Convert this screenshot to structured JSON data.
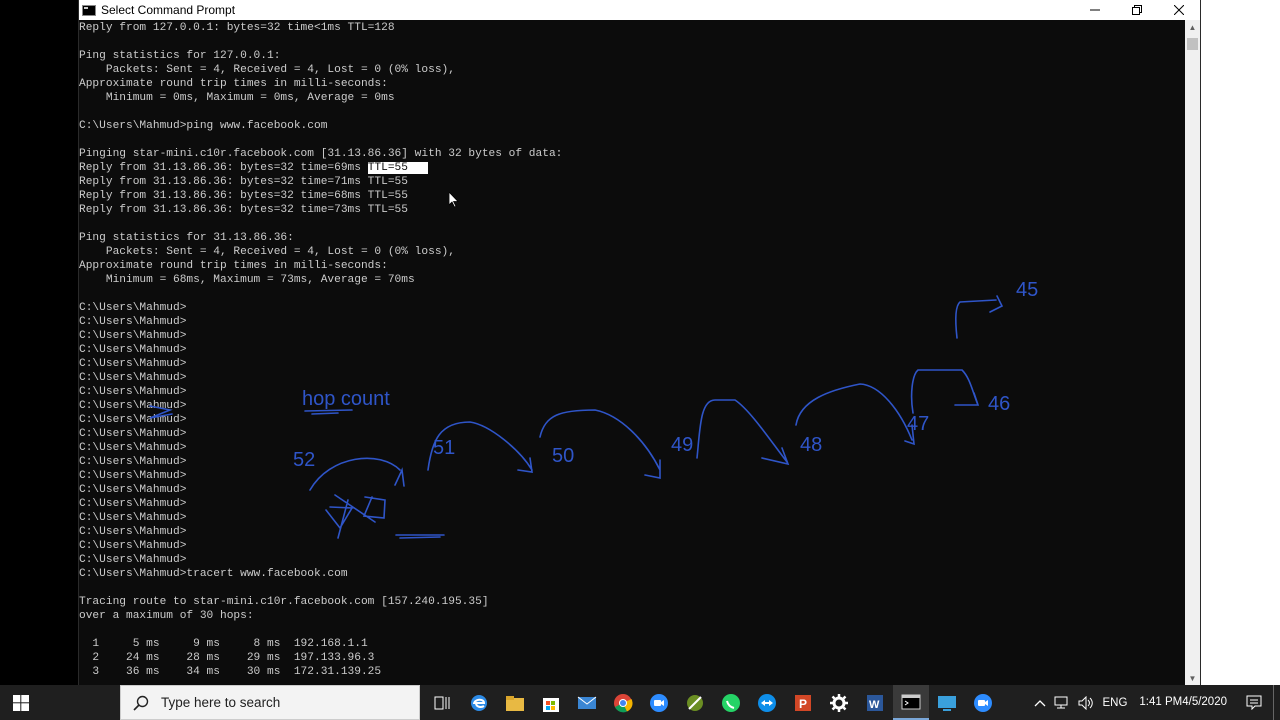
{
  "window": {
    "title": "Select Command Prompt",
    "minimize_icon": "minimize-icon",
    "maximize_icon": "maximize-icon",
    "close_icon": "close-icon"
  },
  "console": {
    "text_before_selection": "Reply from 127.0.0.1: bytes=32 time<1ms TTL=128\n\nPing statistics for 127.0.0.1:\n    Packets: Sent = 4, Received = 4, Lost = 0 (0% loss),\nApproximate round trip times in milli-seconds:\n    Minimum = 0ms, Maximum = 0ms, Average = 0ms\n\nC:\\Users\\Mahmud>ping www.facebook.com\n\nPinging star-mini.c10r.facebook.com [31.13.86.36] with 32 bytes of data:\nReply from 31.13.86.36: bytes=32 time=69ms ",
    "selected_text": "TTL=55   ",
    "text_after_selection": "\nReply from 31.13.86.36: bytes=32 time=71ms TTL=55\nReply from 31.13.86.36: bytes=32 time=68ms TTL=55\nReply from 31.13.86.36: bytes=32 time=73ms TTL=55\n\nPing statistics for 31.13.86.36:\n    Packets: Sent = 4, Received = 4, Lost = 0 (0% loss),\nApproximate round trip times in milli-seconds:\n    Minimum = 68ms, Maximum = 73ms, Average = 70ms\n\nC:\\Users\\Mahmud>\nC:\\Users\\Mahmud>\nC:\\Users\\Mahmud>\nC:\\Users\\Mahmud>\nC:\\Users\\Mahmud>\nC:\\Users\\Mahmud>\nC:\\Users\\Mahmud>\nC:\\Users\\Mahmud>\nC:\\Users\\Mahmud>\nC:\\Users\\Mahmud>\nC:\\Users\\Mahmud>\nC:\\Users\\Mahmud>\nC:\\Users\\Mahmud>\nC:\\Users\\Mahmud>\nC:\\Users\\Mahmud>\nC:\\Users\\Mahmud>\nC:\\Users\\Mahmud>\nC:\\Users\\Mahmud>\nC:\\Users\\Mahmud>\nC:\\Users\\Mahmud>tracert www.facebook.com\n\nTracing route to star-mini.c10r.facebook.com [157.240.195.35]\nover a maximum of 30 hops:\n\n  1     5 ms     9 ms     8 ms  192.168.1.1\n  2    24 ms    28 ms    29 ms  197.133.96.3\n  3    36 ms    34 ms    30 ms  172.31.139.25"
  },
  "annotations": {
    "hop_count_label": "hop count",
    "ttl_values": [
      "52",
      "51",
      "50",
      "49",
      "48",
      "47",
      "46",
      "45"
    ],
    "ink_color": "#2f55c8"
  },
  "taskbar": {
    "search_placeholder": "Type here to search",
    "apps": [
      "task-view-icon",
      "edge-icon",
      "file-explorer-icon",
      "store-icon",
      "mail-icon",
      "chrome-icon",
      "zoom-icon",
      "sniping-tool-icon",
      "whatsapp-icon",
      "teamviewer-icon",
      "powerpoint-icon",
      "settings-icon",
      "word-icon",
      "command-prompt-icon",
      "remote-desktop-icon",
      "zoom-meeting-icon"
    ],
    "language": "ENG",
    "time": "1:41 PM",
    "date": "4/5/2020"
  },
  "colors": {
    "console_bg": "#0c0c0c",
    "console_text": "#cccccc",
    "taskbar_bg": "#1f1f1f"
  }
}
